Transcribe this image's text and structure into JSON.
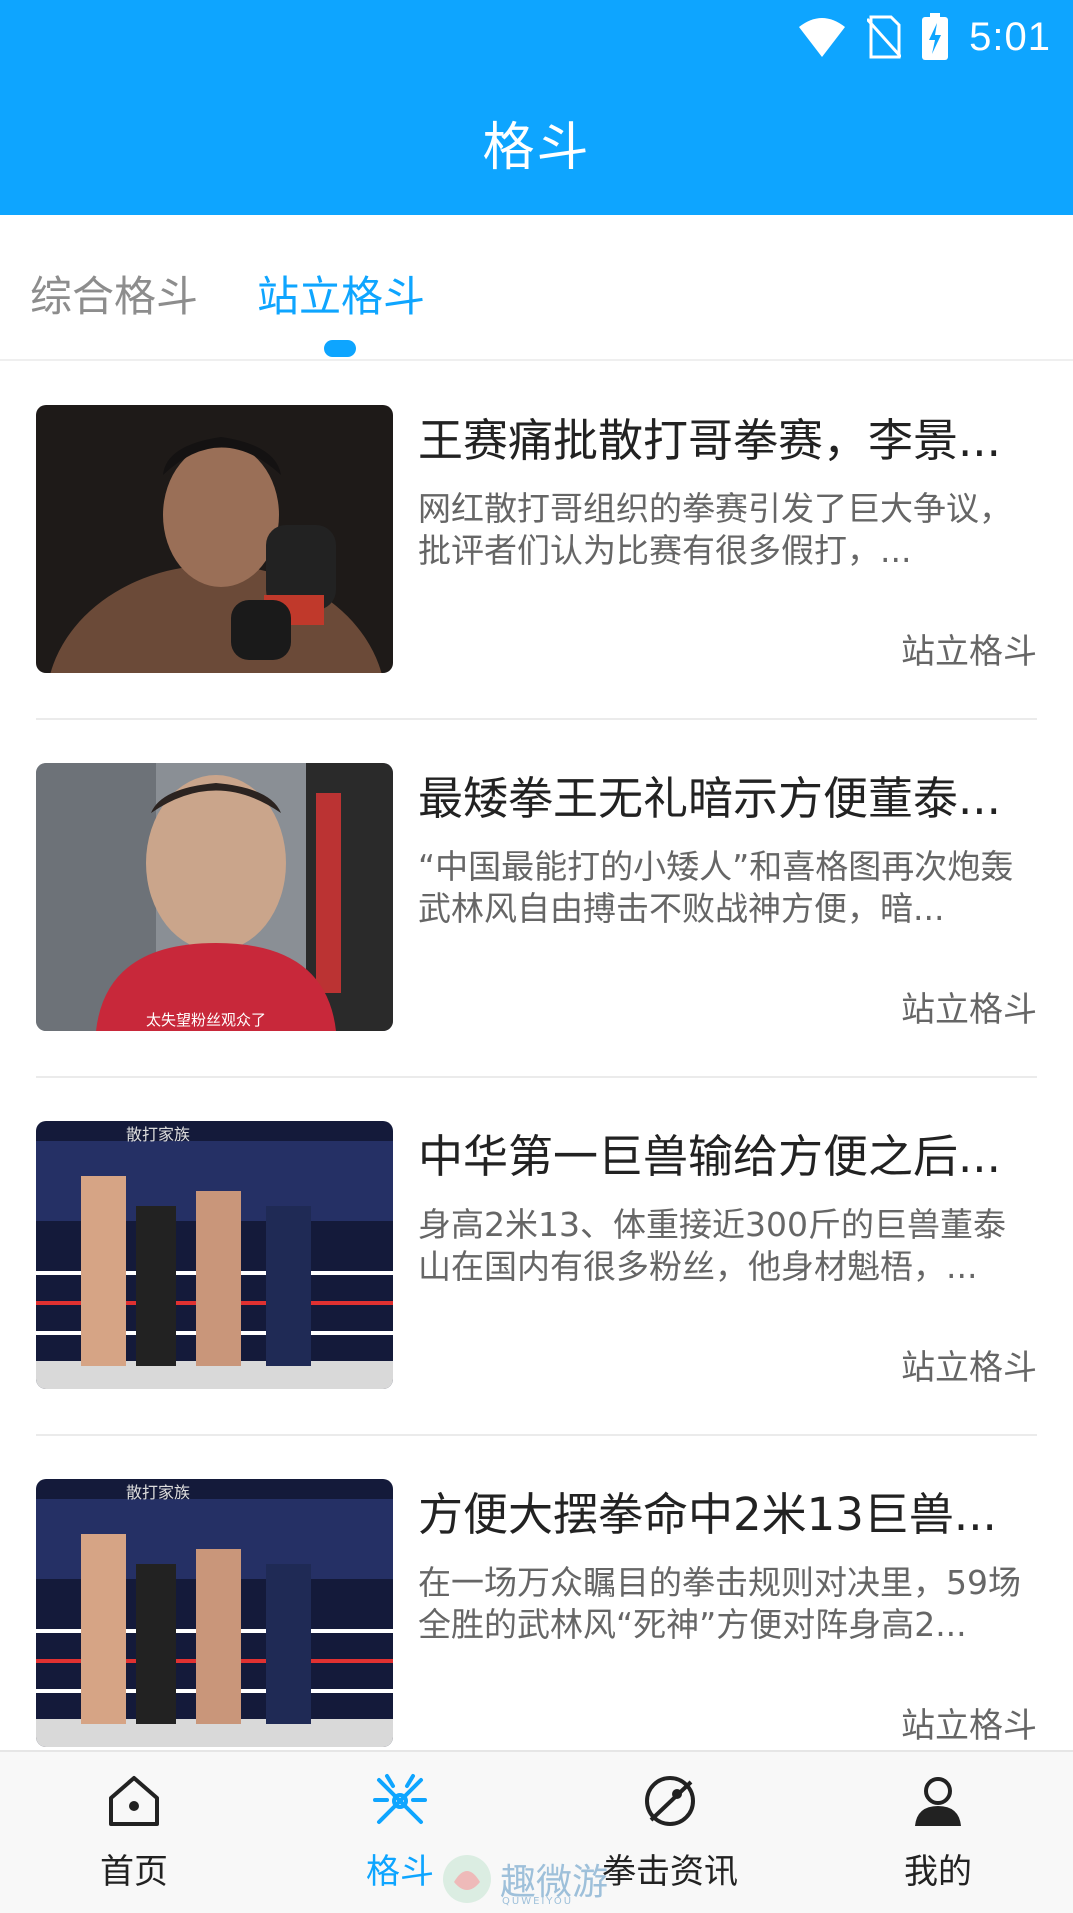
{
  "status_bar": {
    "time": "5:01",
    "icons": [
      "wifi-icon",
      "no-sim-icon",
      "battery-charging-icon"
    ]
  },
  "header": {
    "title": "格斗"
  },
  "tabs": [
    {
      "label": "综合格斗",
      "active": false
    },
    {
      "label": "站立格斗",
      "active": true
    }
  ],
  "articles": [
    {
      "title": "王赛痛批散打哥拳赛，李景...",
      "desc": "网红散打哥组织的拳赛引发了巨大争议，批评者们认为比赛有很多假打，...",
      "tag": "站立格斗",
      "thumb_caption": ""
    },
    {
      "title": "最矮拳王无礼暗示方便董泰...",
      "desc": "“中国最能打的小矮人”和喜格图再次炮轰武林风自由搏击不败战神方便，暗...",
      "tag": "站立格斗",
      "thumb_caption": "太失望粉丝观众了"
    },
    {
      "title": "中华第一巨兽输给方便之后...",
      "desc": "身高2米13、体重接近300斤的巨兽董泰山在国内有很多粉丝，他身材魁梧，...",
      "tag": "站立格斗",
      "thumb_caption": "散打家族"
    },
    {
      "title": "方便大摆拳命中2米13巨兽...",
      "desc": "在一场万众瞩目的拳击规则对决里，59场全胜的武林风“死神”方便对阵身高2...",
      "tag": "站立格斗",
      "thumb_caption": "散打家族"
    }
  ],
  "bottom_nav": [
    {
      "label": "首页",
      "icon": "home-icon",
      "active": false
    },
    {
      "label": "格斗",
      "icon": "fight-icon",
      "active": true
    },
    {
      "label": "拳击资讯",
      "icon": "boxing-news-icon",
      "active": false
    },
    {
      "label": "我的",
      "icon": "profile-icon",
      "active": false
    }
  ],
  "watermark": {
    "text": "趣微游",
    "subtext": "QUWEIYOU"
  },
  "colors": {
    "accent": "#0ea5ff",
    "text_primary": "#222222",
    "text_secondary": "#666666",
    "tab_inactive": "#8d8d8d"
  }
}
